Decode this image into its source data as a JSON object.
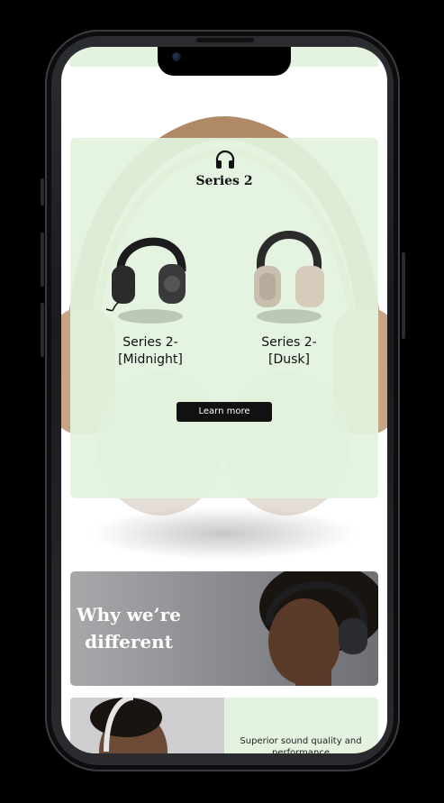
{
  "series": {
    "title": "Series 2",
    "icon": "headphones-icon",
    "products": [
      {
        "name": "Series 2-\n[Midnight]",
        "line1": "Series 2-",
        "line2": "[Midnight]",
        "color": "#2b2b2d"
      },
      {
        "name": "Series 2-\n[Dusk]",
        "line1": "Series 2-",
        "line2": "[Dusk]",
        "color": "#c9bfae"
      }
    ],
    "cta_label": "Learn more"
  },
  "why": {
    "line1": "Why we’re",
    "line2": "different"
  },
  "feature": {
    "text": "Superior sound quality and performance"
  },
  "colors": {
    "accent_bg": "#e3f3df",
    "button": "#111111"
  }
}
